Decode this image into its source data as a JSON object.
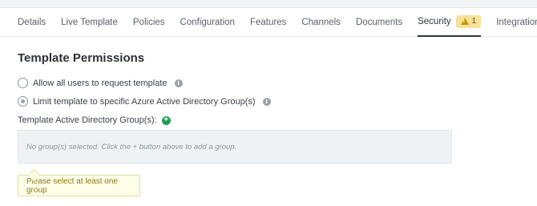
{
  "tabs": [
    {
      "label": "Details"
    },
    {
      "label": "Live Template"
    },
    {
      "label": "Policies"
    },
    {
      "label": "Configuration"
    },
    {
      "label": "Features"
    },
    {
      "label": "Channels"
    },
    {
      "label": "Documents"
    },
    {
      "label": "Security",
      "badge": "1",
      "active": true
    },
    {
      "label": "Integrations"
    }
  ],
  "section": {
    "title": "Template Permissions"
  },
  "options": {
    "allow_all": "Allow all users to request template",
    "limit_groups": "Limit template to specific Azure Active Directory Group(s)"
  },
  "groups": {
    "label": "Template Active Directory Group(s):",
    "empty_text": "No group(s) selected. Click the + button above to add a group."
  },
  "validation": {
    "message": "Please select at least one group"
  },
  "colors": {
    "warning_badge": "#f7e29a",
    "add_icon": "#1f9d55",
    "tooltip_bg": "#fdfde8"
  }
}
